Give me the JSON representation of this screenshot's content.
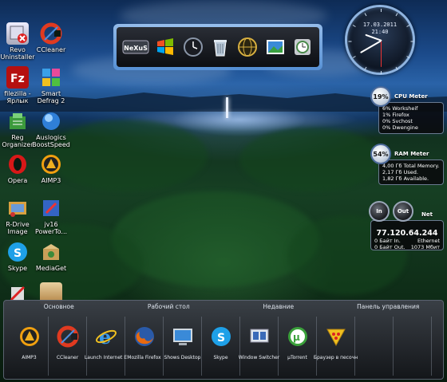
{
  "desktop_icons": [
    {
      "label": "Revo Uninstaller",
      "icon": "revo-icon"
    },
    {
      "label": "CCleaner",
      "icon": "ccleaner-icon"
    },
    {
      "label": "filezilla - Ярлык",
      "icon": "filezilla-icon"
    },
    {
      "label": "Smart Defrag 2",
      "icon": "smart-defrag-icon"
    },
    {
      "label": "Reg Organizer",
      "icon": "reg-organizer-icon"
    },
    {
      "label": "Auslogics BoostSpeed",
      "icon": "auslogics-icon"
    },
    {
      "label": "Opera",
      "icon": "opera-icon"
    },
    {
      "label": "AIMP3",
      "icon": "aimp-icon"
    },
    {
      "label": "R-Drive Image",
      "icon": "rdrive-icon"
    },
    {
      "label": "jv16 PowerTo...",
      "icon": "jv16-icon"
    },
    {
      "label": "Skype",
      "icon": "skype-icon"
    },
    {
      "label": "MediaGet",
      "icon": "mediaget-icon"
    }
  ],
  "top_dock": {
    "items": [
      {
        "name": "nexus-logo",
        "label": "NeXuS"
      },
      {
        "name": "windows-icon"
      },
      {
        "name": "clock-icon"
      },
      {
        "name": "recycle-bin-icon"
      },
      {
        "name": "globe-icon"
      },
      {
        "name": "photo-icon"
      },
      {
        "name": "gadget-icon"
      }
    ]
  },
  "clock": {
    "date": "17.03.2011",
    "time": "21:40",
    "hour": 21,
    "minute": 40,
    "second": 30
  },
  "cpu_meter": {
    "percent": "19%",
    "title": "CPU Meter",
    "lines": [
      "6% Worksheif",
      "1% Firefox",
      "0% Svchost",
      "0% Dwengine"
    ]
  },
  "ram_meter": {
    "percent": "54%",
    "title": "RAM Meter",
    "lines": [
      "4,00 Гб Total Memory.",
      "2,17 Гб Used.",
      "1,82 Гб Available."
    ]
  },
  "net_meter": {
    "in_label": "In",
    "out_label": "Out",
    "title": "Net",
    "ip": "77.120.64.244",
    "rows": [
      {
        "left": "0 Байт In.",
        "right": "Ethernet"
      },
      {
        "left": "0 Байт Out.",
        "right": "1073 Мбит"
      }
    ]
  },
  "taskbar": {
    "tabs": [
      "Основное",
      "Рабочий стол",
      "Недавние",
      "Панель управления"
    ],
    "items": [
      {
        "label": "AIMP3",
        "icon": "aimp-icon"
      },
      {
        "label": "CCleaner",
        "icon": "ccleaner-icon"
      },
      {
        "label": "Launch Internet E",
        "icon": "ie-icon"
      },
      {
        "label": "Mozilla Firefox",
        "icon": "firefox-icon"
      },
      {
        "label": "Shows Desktop",
        "icon": "desktop-icon"
      },
      {
        "label": "Skype",
        "icon": "skype-icon"
      },
      {
        "label": "Window Switcher",
        "icon": "window-switcher-icon"
      },
      {
        "label": "µTorrent",
        "icon": "utorrent-icon"
      },
      {
        "label": "Браузер в песочн",
        "icon": "sandboxie-icon"
      }
    ]
  },
  "colors": {
    "accent_blue": "#5a9ae0",
    "dock_frame": "#8fc0f0",
    "panel_bg": "#0c0c0e"
  }
}
